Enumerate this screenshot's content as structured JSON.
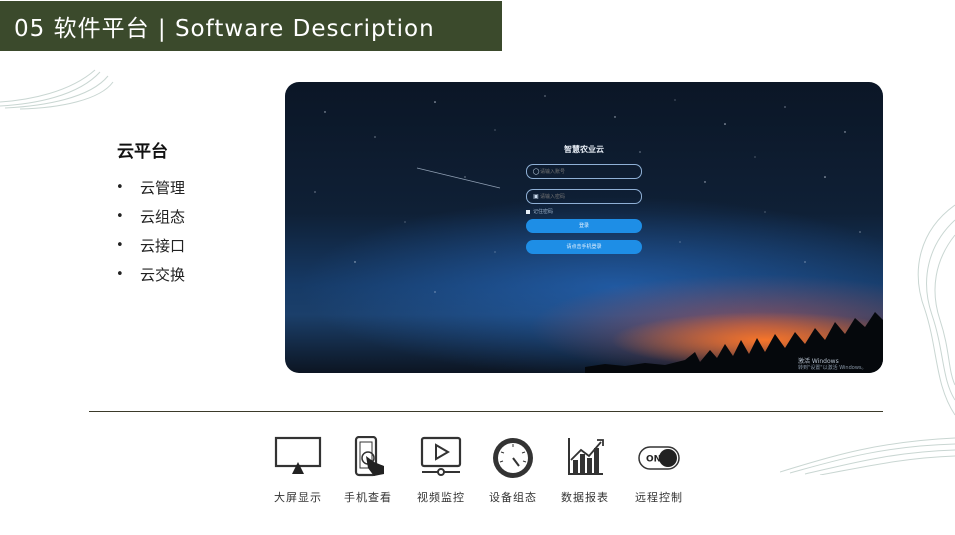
{
  "header": {
    "title": "05  软件平台 | Software Description"
  },
  "section": {
    "title": "云平台",
    "bullets": [
      "云管理",
      "云组态",
      "云接口",
      "云交换"
    ]
  },
  "login": {
    "title": "智慧农业云",
    "username_placeholder": "请输入账号",
    "password_placeholder": "请输入密码",
    "remember_label": "记住密码",
    "login_button": "登录",
    "mobile_button": "请点击手机登录"
  },
  "watermark": {
    "line1": "激活 Windows",
    "line2": "转到\"设置\"以激活 Windows。"
  },
  "features": [
    {
      "label": "大屏显示",
      "icon": "monitor-icon"
    },
    {
      "label": "手机查看",
      "icon": "phone-touch-icon"
    },
    {
      "label": "视频监控",
      "icon": "video-play-icon"
    },
    {
      "label": "设备组态",
      "icon": "dial-gauge-icon"
    },
    {
      "label": "数据报表",
      "icon": "bar-chart-icon"
    },
    {
      "label": "远程控制",
      "icon": "toggle-switch-icon"
    }
  ],
  "toggle": {
    "label": "ON"
  },
  "colors": {
    "header_bg": "#3b4a2c",
    "button_blue": "#1e8ee6"
  }
}
